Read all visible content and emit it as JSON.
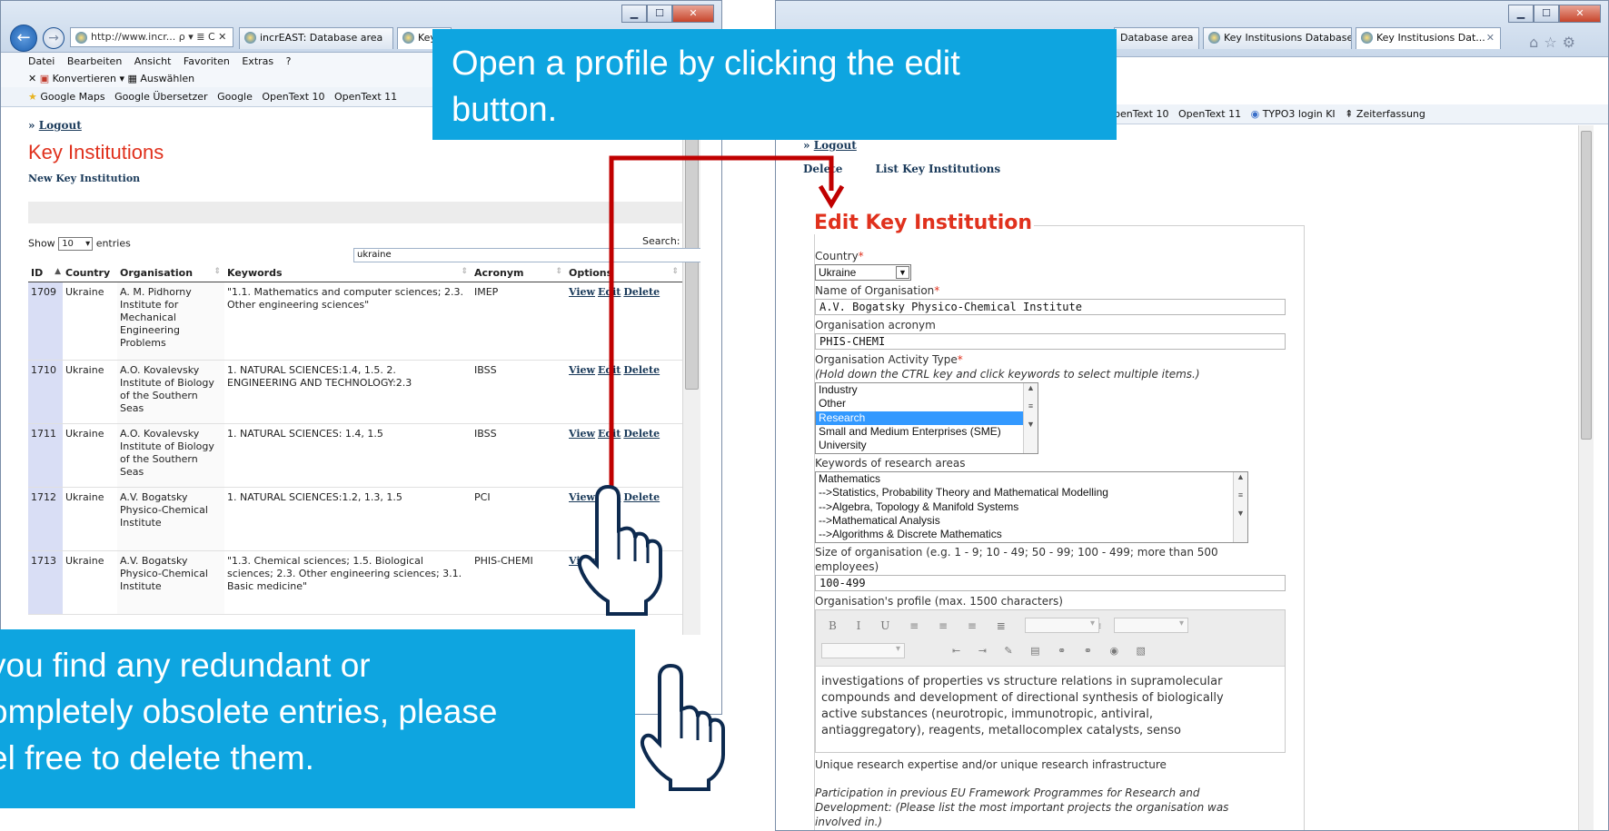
{
  "left_window": {
    "address": "http://www.incr...",
    "address_controls": "ρ ▾ ≣ C ✕",
    "tabs": [
      {
        "label": "incrEAST: Database area"
      },
      {
        "label": "Key"
      }
    ],
    "menu": [
      "Datei",
      "Bearbeiten",
      "Ansicht",
      "Favoriten",
      "Extras",
      "?"
    ],
    "toolbar": {
      "convert": "Konvertieren",
      "select": "Auswählen"
    },
    "favorites": [
      "Google Maps",
      "Google Übersetzer",
      "Google",
      "OpenText 10",
      "OpenText 11"
    ]
  },
  "right_window": {
    "tabs": [
      {
        "label": "Database area"
      },
      {
        "label": "Key Institusions Database"
      },
      {
        "label": "Key Institusions Dat..."
      }
    ],
    "favorites": [
      "penText 10",
      "OpenText 11",
      "TYPO3 login KI",
      "Zeiterfassung"
    ]
  },
  "list_page": {
    "logout_prefix": "»",
    "logout": "Logout",
    "title": "Key Institutions",
    "new_link": "New Key Institution",
    "show_label": "Show",
    "entries_value": "10",
    "entries_label": "entries",
    "search_label": "Search:",
    "search_value": "ukraine",
    "columns": [
      "ID",
      "Country",
      "Organisation",
      "Keywords",
      "Acronym",
      "Options"
    ],
    "rows": [
      {
        "id": "1709",
        "country": "Ukraine",
        "organisation": "A. M. Pidhorny Institute for Mechanical Engineering Problems",
        "keywords": "\"1.1. Mathematics and computer sciences; 2.3. Other engineering sciences\"",
        "acronym": "IMEP"
      },
      {
        "id": "1710",
        "country": "Ukraine",
        "organisation": "A.O. Kovalevsky Institute of Biology of the Southern Seas",
        "keywords": "1. NATURAL SCIENCES:1.4, 1.5. 2. ENGINEERING AND TECHNOLOGY:2.3",
        "acronym": "IBSS"
      },
      {
        "id": "1711",
        "country": "Ukraine",
        "organisation": "A.O. Kovalevsky Institute of Biology of the Southern Seas",
        "keywords": "1. NATURAL SCIENCES: 1.4, 1.5",
        "acronym": "IBSS"
      },
      {
        "id": "1712",
        "country": "Ukraine",
        "organisation": "A.V. Bogatsky Physico-Chemical Institute",
        "keywords": "1. NATURAL SCIENCES:1.2, 1.3, 1.5",
        "acronym": "PCI"
      },
      {
        "id": "1713",
        "country": "Ukraine",
        "organisation": "A.V. Bogatsky Physico-Chemical Institute",
        "keywords": "\"1.3. Chemical sciences; 1.5. Biological sciences; 2.3. Other engineering sciences; 3.1. Basic medicine\"",
        "acronym": "PHIS-CHEMI"
      }
    ],
    "options": {
      "view": "View",
      "edit": "Edit",
      "delete": "Delete"
    }
  },
  "edit_page": {
    "logout_prefix": "»",
    "logout": "Logout",
    "delete_link": "Delete",
    "list_link": "List Key Institutions",
    "legend": "Edit Key Institution",
    "country_label": "Country",
    "country_value": "Ukraine",
    "name_label": "Name of Organisation",
    "name_value": "A.V. Bogatsky Physico-Chemical Institute",
    "acronym_label": "Organisation acronym",
    "acronym_value": "PHIS-CHEMI",
    "activity_label": "Organisation Activity Type",
    "activity_hint": "(Hold down the CTRL key and click keywords to select multiple items.)",
    "activity_options": [
      "Industry",
      "Other",
      "Research",
      "Small and Medium Enterprises (SME)",
      "University"
    ],
    "activity_selected": "Research",
    "research_label": "Keywords of research areas",
    "research_options": [
      "Mathematics",
      "-->Statistics, Probability Theory and Mathematical Modelling",
      "-->Algebra, Topology & Manifold Systems",
      "-->Mathematical Analysis",
      "-->Algorithms & Discrete Mathematics"
    ],
    "size_label_1": "Size of organisation (e.g. 1 - 9; 10 - 49; 50 - 99; 100 - 499; more than 500",
    "size_label_2": "employees)",
    "size_value": "100-499",
    "profile_label": "Organisation's profile (max. 1500 characters)",
    "profile_lines": [
      "investigations of properties vs structure relations in supramolecular",
      "compounds and development of directional synthesis of biologically",
      "active substances (neurotropic, immunotropic, antiviral,",
      "antiaggregatory), reagents, metallocomplex catalysts, senso"
    ],
    "expertise_label": "Unique research expertise and/or unique research infrastructure",
    "participation_1": "Participation in previous EU Framework Programmes for Research and",
    "participation_2": "Development: (Please list the most important projects the organisation was",
    "participation_3": "involved in.)"
  },
  "callouts": {
    "top_1": "Open a profile by clicking the edit",
    "top_2": "button.",
    "bottom_1": "you find any redundant or",
    "bottom_2": "ompletely obsolete entries, please",
    "bottom_3": "el free to delete them."
  },
  "colors": {
    "accent_red": "#e0311d",
    "callout_blue": "#0ea5e0",
    "arrow_red": "#c00000",
    "selection_blue": "#3399ff"
  }
}
